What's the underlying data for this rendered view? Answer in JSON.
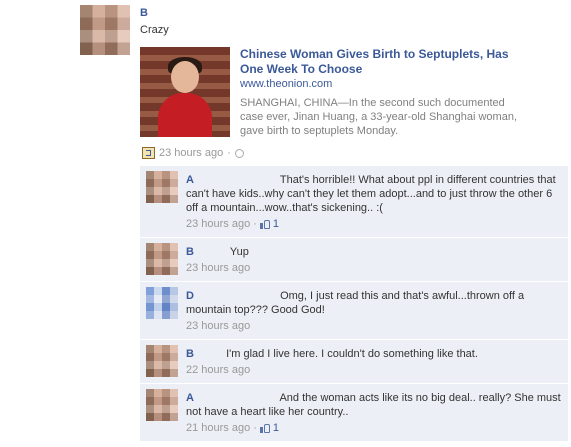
{
  "post": {
    "author": "B",
    "message": "Crazy",
    "attachment": {
      "title": "Chinese Woman Gives Birth to Septuplets, Has One Week To Choose",
      "url": "www.theonion.com",
      "description": "SHANGHAI, CHINA—In the second such documented case ever, Jinan Huang, a 33-year-old Shanghai woman, gave birth to septuplets Monday."
    },
    "timestamp": "23 hours ago",
    "separator": "·"
  },
  "comments": [
    {
      "name": "A",
      "text": "That's horrible!! What about ppl in different countries that can't have kids..why can't they let them adopt...and to just throw the other 6 off a mountain...wow..that's sickening.. :(",
      "time": "23 hours ago",
      "likes": "1"
    },
    {
      "name": "B",
      "text": "Yup",
      "time": "23 hours ago"
    },
    {
      "name": "D",
      "text": "Omg, I just read this and that's awful...thrown off a mountain top??? Good God!",
      "time": "23 hours ago"
    },
    {
      "name": "B",
      "text": "I'm glad I live here. I couldn't do something like that.",
      "time": "22 hours ago"
    },
    {
      "name": "A",
      "text": "And the woman acts like its no big deal.. really? She must not have a heart like her country..",
      "time": "21 hours ago",
      "likes": "1"
    }
  ],
  "colors": {
    "link": "#3b5998",
    "comment_bg": "#eceff5",
    "meta": "#999999"
  },
  "icons": {
    "share": "share-icon",
    "privacy": "globe-icon",
    "like": "thumbs-up-icon"
  }
}
